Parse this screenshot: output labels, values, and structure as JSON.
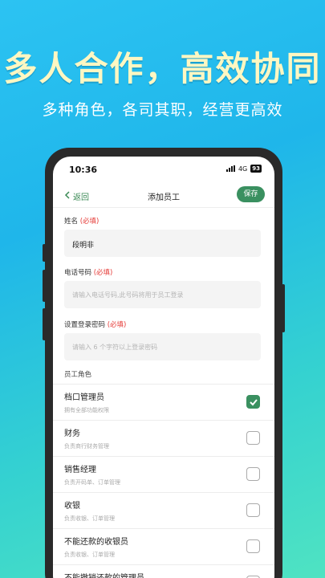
{
  "banner": {
    "headline": "多人合作，高效协同",
    "subline": "多种角色，各司其职，经营更高效"
  },
  "status": {
    "time": "10:36",
    "network": "4G",
    "battery": "93"
  },
  "nav": {
    "back_label": "返回",
    "title": "添加员工",
    "save_label": "保存"
  },
  "form": {
    "name": {
      "label": "姓名",
      "required": "(必填)",
      "value": "段明非"
    },
    "phone": {
      "label": "电话号码",
      "required": "(必填)",
      "placeholder": "请输入电话号码,此号码将用于员工登录"
    },
    "password": {
      "label": "设置登录密码",
      "required": "(必填)",
      "placeholder": "请输入 6 个字符以上登录密码"
    }
  },
  "roles_section_label": "员工角色",
  "roles": [
    {
      "name": "档口管理员",
      "desc": "拥有全部功能权限",
      "checked": true
    },
    {
      "name": "财务",
      "desc": "负责商行财务管理",
      "checked": false
    },
    {
      "name": "销售经理",
      "desc": "负责开码单、订单管理",
      "checked": false
    },
    {
      "name": "收银",
      "desc": "负责收银、订单管理",
      "checked": false
    },
    {
      "name": "不能还款的收银员",
      "desc": "负责收银、订单管理",
      "checked": false
    },
    {
      "name": "不能撤销还款的管理员",
      "desc": "",
      "checked": false
    }
  ],
  "colors": {
    "accent": "#3a9060",
    "required": "#e53935"
  }
}
